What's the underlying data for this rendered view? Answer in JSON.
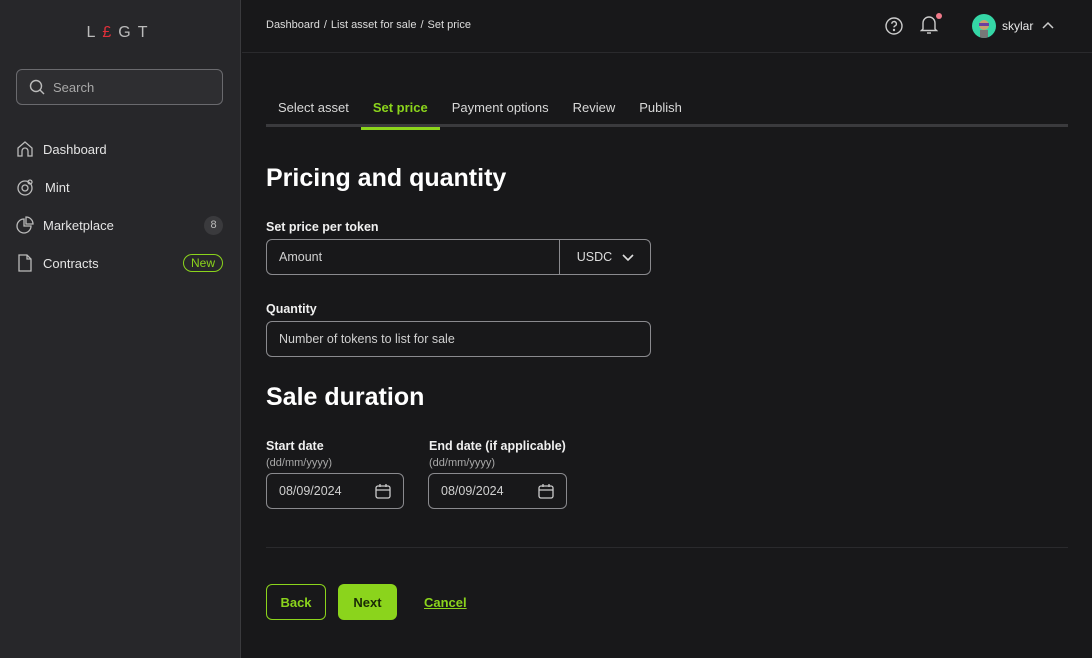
{
  "sidebar": {
    "logo": {
      "l": "L",
      "pound": "£",
      "rest": "GT"
    },
    "search_placeholder": "Search",
    "items": [
      {
        "label": "Dashboard",
        "icon": "home-icon"
      },
      {
        "label": "Mint",
        "icon": "mint-icon"
      },
      {
        "label": "Marketplace",
        "icon": "pie-chart-icon",
        "badge": "8"
      },
      {
        "label": "Contracts",
        "icon": "file-icon",
        "badge": "New"
      }
    ]
  },
  "header": {
    "breadcrumb": [
      "Dashboard",
      "/",
      "List asset for sale",
      "/",
      "Set price"
    ],
    "user": "skylar",
    "notification_dot_color": "#f07a8a"
  },
  "tabs": [
    {
      "label": "Select asset"
    },
    {
      "label": "Set price",
      "active": true
    },
    {
      "label": "Payment options"
    },
    {
      "label": "Review"
    },
    {
      "label": "Publish"
    }
  ],
  "pricing": {
    "title": "Pricing and quantity",
    "price_label": "Set price per token",
    "price_placeholder": "Amount",
    "currency": "USDC",
    "quantity_label": "Quantity",
    "quantity_placeholder": "Number of tokens to list for sale"
  },
  "duration": {
    "title": "Sale duration",
    "start_label": "Start date",
    "start_format": "(dd/mm/yyyy)",
    "start_value": "08/09/2024",
    "end_label": "End date (if applicable)",
    "end_format": "(dd/mm/yyyy)",
    "end_value": "08/09/2024"
  },
  "actions": {
    "back": "Back",
    "next": "Next",
    "cancel": "Cancel"
  },
  "colors": {
    "accent": "#8bd41c",
    "sidebar": "#27272a",
    "background": "#18181a"
  }
}
